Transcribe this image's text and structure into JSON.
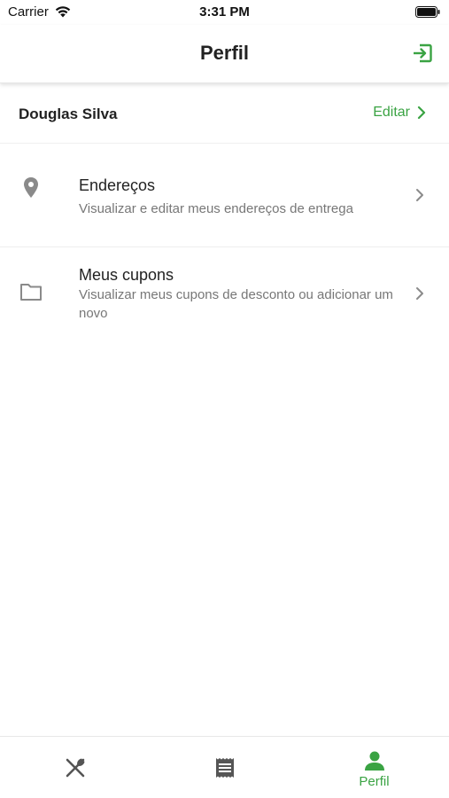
{
  "status_bar": {
    "carrier": "Carrier",
    "time": "3:31 PM"
  },
  "header": {
    "title": "Perfil"
  },
  "profile": {
    "name": "Douglas Silva",
    "edit_label": "Editar"
  },
  "menu": [
    {
      "icon": "location-pin-icon",
      "title": "Endereços",
      "subtitle": "Visualizar e editar meus endereços de entrega"
    },
    {
      "icon": "folder-icon",
      "title": "Meus cupons",
      "subtitle": "Visualizar meus cupons de desconto ou adicionar um novo"
    }
  ],
  "tab_bar": {
    "tabs": [
      {
        "icon": "utensils-icon",
        "label": ""
      },
      {
        "icon": "receipt-icon",
        "label": ""
      },
      {
        "icon": "person-icon",
        "label": "Perfil"
      }
    ],
    "active_index": 2
  },
  "colors": {
    "accent": "#3aa343",
    "icon_gray": "#8a8a8a"
  }
}
